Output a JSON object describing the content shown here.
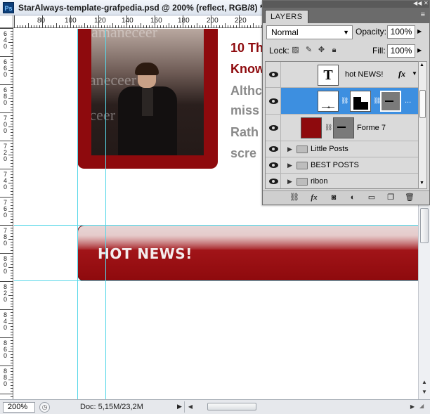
{
  "window": {
    "title": "StarAlways-template-grafpedia.psd @ 200% (reflect, RGB/8) *",
    "app_icon": "Ps"
  },
  "rulers": {
    "horizontal_ticks": [
      "80",
      "100",
      "120",
      "140",
      "160",
      "180",
      "200",
      "220"
    ],
    "vertical_ticks": [
      [
        "6",
        "4",
        "0"
      ],
      [
        "6",
        "6",
        "0"
      ],
      [
        "6",
        "8",
        "0"
      ],
      [
        "7",
        "0",
        "0"
      ],
      [
        "7",
        "2",
        "0"
      ],
      [
        "7",
        "4",
        "0"
      ],
      [
        "7",
        "6",
        "0"
      ],
      [
        "7",
        "8",
        "0"
      ],
      [
        "8",
        "0",
        "0"
      ],
      [
        "8",
        "2",
        "0"
      ],
      [
        "8",
        "4",
        "0"
      ],
      [
        "8",
        "6",
        "0"
      ],
      [
        "8",
        "8",
        "0"
      ]
    ]
  },
  "canvas": {
    "photo_background_text": [
      "amaneceer",
      "amaneceer",
      "amaneceer"
    ],
    "article_title_lines": [
      "10 Th",
      "Know"
    ],
    "article_text_lines": [
      "Althc",
      "miss",
      "Rath",
      "scre"
    ],
    "news_bar_label": "HOT NEWS!",
    "accent_color": "#8e0a0d"
  },
  "status": {
    "zoom": "200%",
    "doc_size": "Doc: 5,15M/23,2M"
  },
  "layers_panel": {
    "tab": "LAYERS",
    "blend_mode": "Normal",
    "opacity_label": "Opacity:",
    "opacity": "100%",
    "lock_label": "Lock:",
    "fill_label": "Fill:",
    "fill": "100%",
    "lock_icons": [
      "transparency-lock-icon",
      "brush-lock-icon",
      "move-lock-icon",
      "padlock-icon"
    ],
    "layers": [
      {
        "name": "hot NEWS!",
        "type": "text",
        "visible": true,
        "selected": false,
        "fx": "fx"
      },
      {
        "name": "...",
        "type": "adjustment",
        "visible": true,
        "selected": true
      },
      {
        "name": "Forme 7",
        "type": "shape",
        "visible": true,
        "selected": false,
        "color": "#8e0a0d"
      },
      {
        "name": "Little Posts",
        "type": "group",
        "visible": true
      },
      {
        "name": "BEST POSTS",
        "type": "group",
        "visible": true
      },
      {
        "name": "ribon",
        "type": "group",
        "visible": true
      }
    ],
    "footer_icons": [
      "link-layers-icon",
      "fx-icon",
      "mask-icon",
      "adjustment-icon",
      "new-group-icon",
      "new-layer-icon",
      "trash-icon"
    ]
  }
}
